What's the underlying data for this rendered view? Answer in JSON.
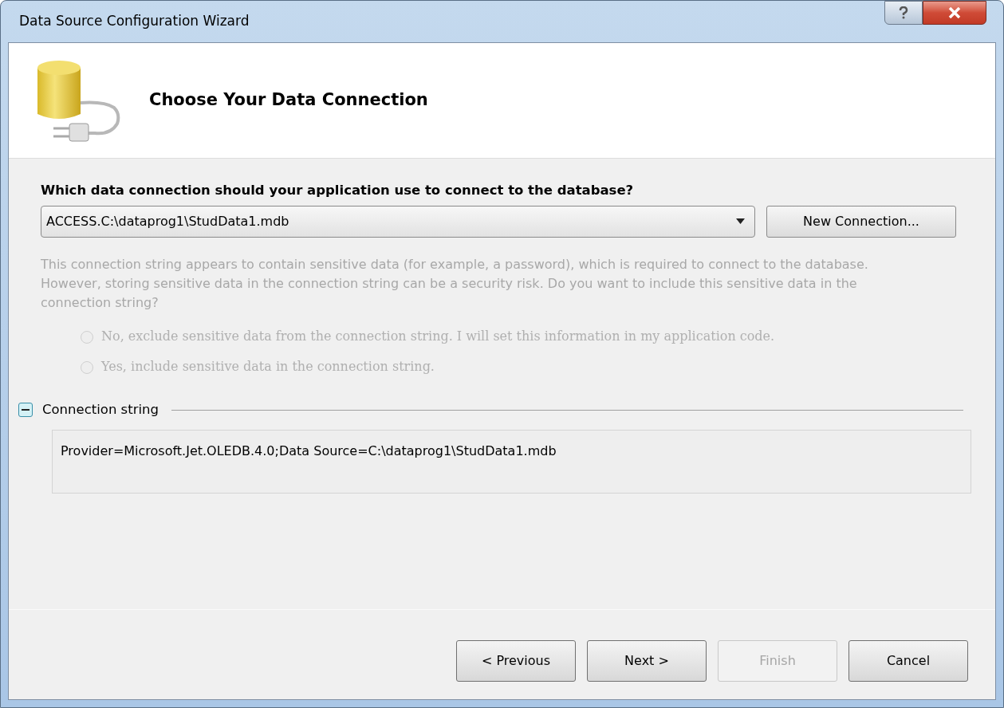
{
  "window": {
    "title": "Data Source Configuration Wizard"
  },
  "header": {
    "title": "Choose Your Data Connection"
  },
  "question": "Which data connection should your application use to connect to the database?",
  "connection_dropdown": {
    "value": "ACCESS.C:\\dataprog1\\StudData1.mdb"
  },
  "new_connection_button": "New Connection...",
  "sensitive_note": {
    "text": "This connection string appears to contain sensitive data (for example, a password), which is required to connect to the database. However, storing sensitive data in the connection string can be a security risk. Do you want to include this sensitive data in the connection string?",
    "disabled": true
  },
  "options": [
    {
      "label": "No, exclude sensitive data from the connection string. I will set this information in my application code.",
      "selected": false,
      "disabled": true
    },
    {
      "label": "Yes, include sensitive data in the connection string.",
      "selected": false,
      "disabled": true
    }
  ],
  "connection_string": {
    "label": "Connection string",
    "expanded": true,
    "value": "Provider=Microsoft.Jet.OLEDB.4.0;Data Source=C:\\dataprog1\\StudData1.mdb"
  },
  "buttons": [
    {
      "label": "< Previous",
      "disabled": false
    },
    {
      "label": "Next >",
      "disabled": false
    },
    {
      "label": "Finish",
      "disabled": true
    },
    {
      "label": "Cancel",
      "disabled": false
    }
  ]
}
